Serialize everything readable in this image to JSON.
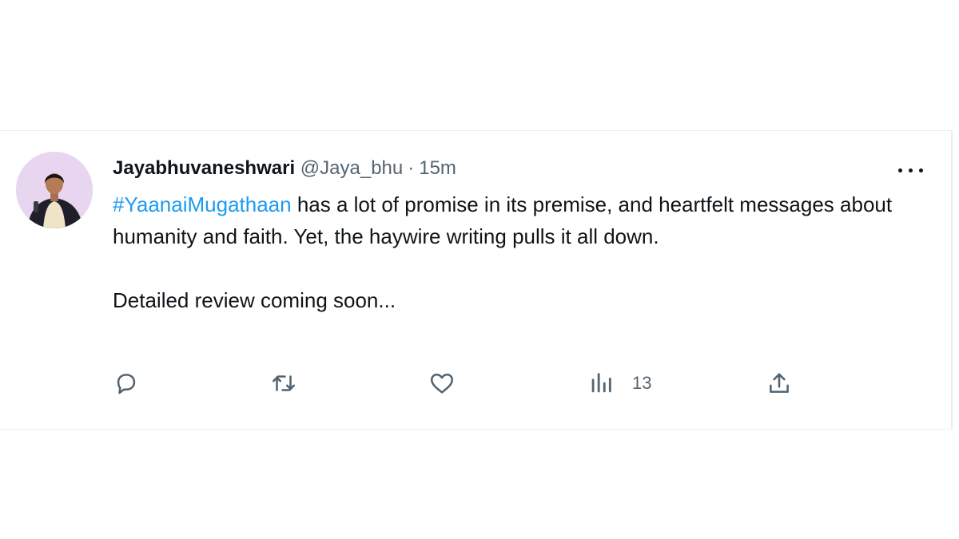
{
  "tweet": {
    "author_name": "Jayabhuvaneshwari",
    "handle": "@Jaya_bhu",
    "separator": "·",
    "time": "15m",
    "hashtag": "#YaanaiMugathaan",
    "body_rest": " has a lot of promise in its premise, and  heartfelt messages about humanity and faith. Yet, the haywire writing pulls it all down.",
    "body_second": "Detailed review coming soon...",
    "avatar_icon": "avatar-photo",
    "more_icon": "more-horizontal-icon"
  },
  "actions": {
    "reply_icon": "reply-icon",
    "retweet_icon": "retweet-icon",
    "like_icon": "like-icon",
    "views_icon": "views-icon",
    "views_count": "13",
    "share_icon": "share-icon"
  },
  "colors": {
    "accent": "#1d9bf0",
    "text_primary": "#0f1419",
    "text_secondary": "#536471"
  }
}
